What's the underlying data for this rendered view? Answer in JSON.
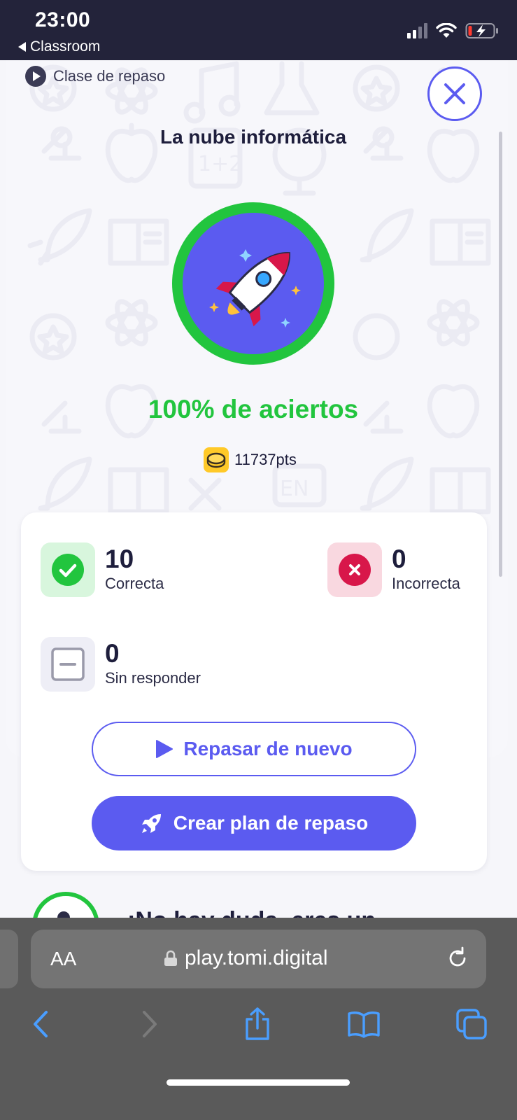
{
  "status_bar": {
    "time": "23:00",
    "back_app": "Classroom"
  },
  "header": {
    "breadcrumb": "Clase de repaso"
  },
  "lesson": {
    "title": "La nube informática"
  },
  "result": {
    "score_text": "100% de aciertos",
    "points": "11737pts"
  },
  "stats": [
    {
      "value": "10",
      "label": "Correcta"
    },
    {
      "value": "0",
      "label": "Incorrecta"
    },
    {
      "value": "0",
      "label": "Sin responder"
    }
  ],
  "actions": {
    "review_again": "Repasar de nuevo",
    "create_plan": "Crear plan de repaso"
  },
  "next_section": {
    "heading_partial": "¡No hay duda, eres un"
  },
  "browser": {
    "text_size_label": "AA",
    "url": "play.tomi.digital"
  },
  "colors": {
    "accent": "#5b5bf0",
    "success": "#22c53e",
    "error": "#d8174a",
    "status_bar": "#23233a",
    "browser_bar": "#5a5a5a"
  }
}
